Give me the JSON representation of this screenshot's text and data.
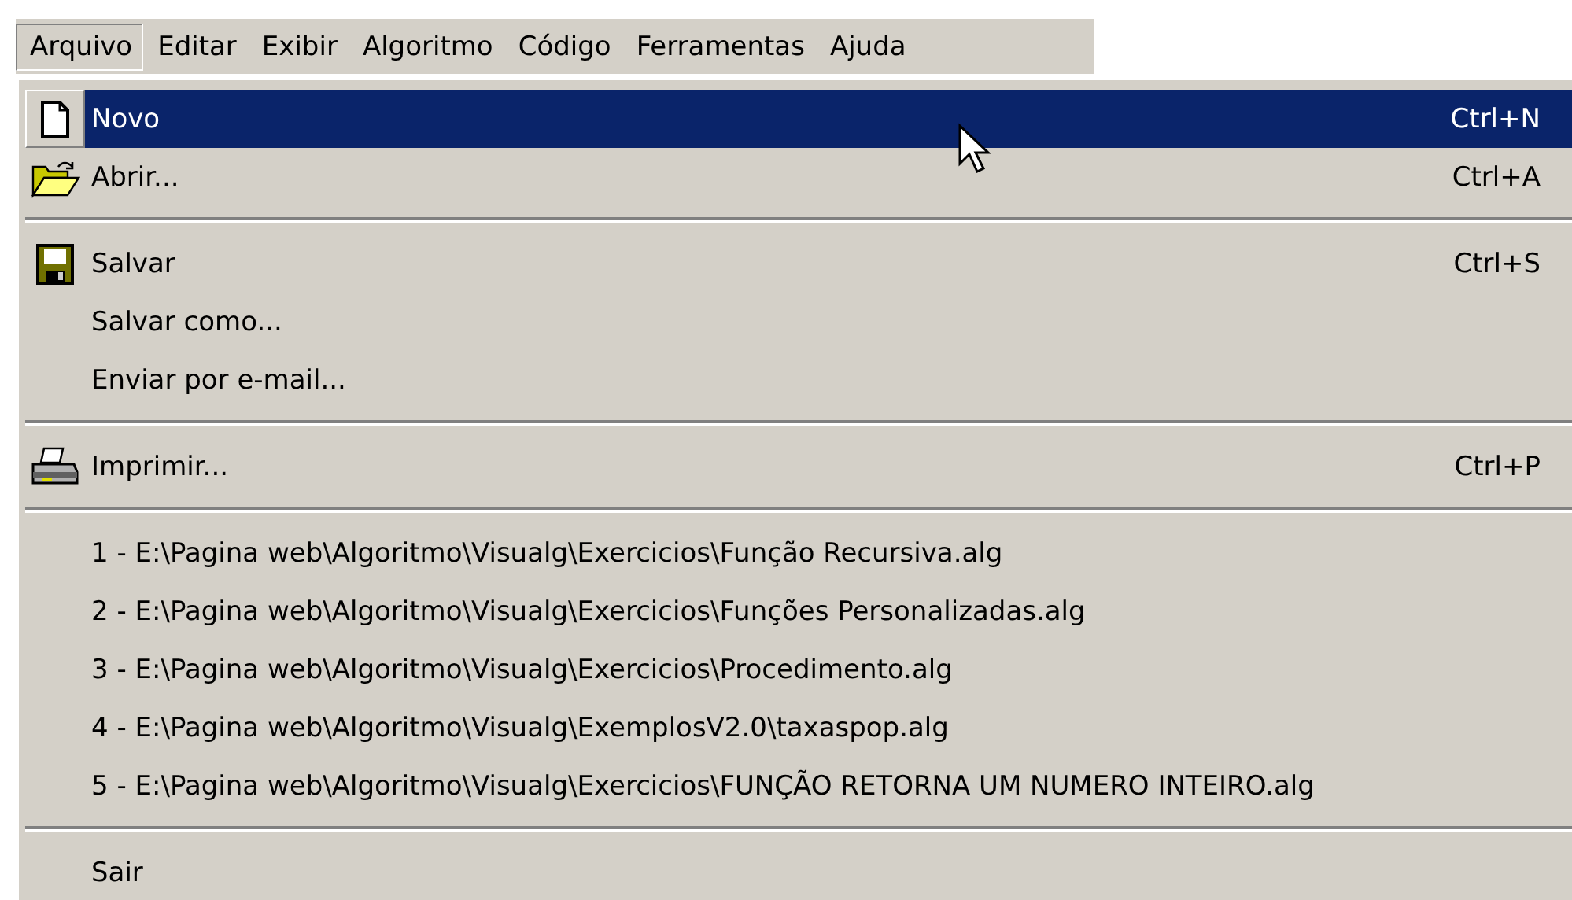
{
  "menubar": [
    {
      "label": "Arquivo",
      "selected": true
    },
    {
      "label": "Editar",
      "selected": false
    },
    {
      "label": "Exibir",
      "selected": false
    },
    {
      "label": "Algoritmo",
      "selected": false
    },
    {
      "label": "Código",
      "selected": false
    },
    {
      "label": "Ferramentas",
      "selected": false
    },
    {
      "label": "Ajuda",
      "selected": false
    }
  ],
  "menu": {
    "items": [
      {
        "kind": "item",
        "label": "Novo",
        "shortcut": "Ctrl+N",
        "selected": true
      },
      {
        "kind": "item",
        "label": "Abrir...",
        "shortcut": "Ctrl+A",
        "selected": false
      },
      {
        "kind": "separator"
      },
      {
        "kind": "item",
        "label": "Salvar",
        "shortcut": "Ctrl+S",
        "selected": false
      },
      {
        "kind": "item",
        "label": "Salvar como...",
        "selected": false
      },
      {
        "kind": "item",
        "label": "Enviar por e-mail...",
        "selected": false
      },
      {
        "kind": "separator"
      },
      {
        "kind": "item",
        "label": "Imprimir...",
        "shortcut": "Ctrl+P",
        "selected": false
      },
      {
        "kind": "separator"
      },
      {
        "kind": "item",
        "label": "1 - E:\\Pagina web\\Algoritmo\\Visualg\\Exercicios\\Função Recursiva.alg",
        "selected": false
      },
      {
        "kind": "item",
        "label": "2 - E:\\Pagina web\\Algoritmo\\Visualg\\Exercicios\\Funções Personalizadas.alg",
        "selected": false
      },
      {
        "kind": "item",
        "label": "3 - E:\\Pagina web\\Algoritmo\\Visualg\\Exercicios\\Procedimento.alg",
        "selected": false
      },
      {
        "kind": "item",
        "label": "4 - E:\\Pagina web\\Algoritmo\\Visualg\\ExemplosV2.0\\taxaspop.alg",
        "selected": false
      },
      {
        "kind": "item",
        "label": "5 - E:\\Pagina web\\Algoritmo\\Visualg\\Exercicios\\FUNÇÃO RETORNA UM NUMERO INTEIRO.alg",
        "selected": false
      },
      {
        "kind": "separator"
      },
      {
        "kind": "item",
        "label": "Sair",
        "selected": false
      }
    ]
  }
}
